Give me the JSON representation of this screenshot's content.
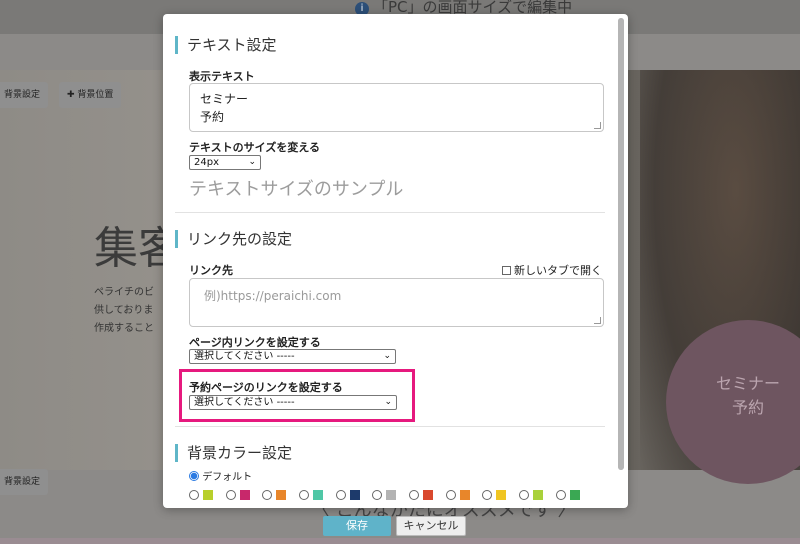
{
  "background": {
    "top_notice": "「PC」の画面サイズで編集中",
    "buttons": {
      "bg_setting": "背景設定",
      "bg_position": "✚ 背景位置"
    },
    "hero_heading": "集客",
    "hero_para_lines": [
      "ペライチのビ",
      "供しておりま",
      "作成すること"
    ],
    "circle_line1": "セミナー",
    "circle_line2": "予約",
    "bottom_text": "〈 こんなかたにオススメです 〉"
  },
  "modal": {
    "text_section": {
      "title": "テキスト設定",
      "display_text_label": "表示テキスト",
      "display_text_line1": "セミナー",
      "display_text_line2": "予約",
      "size_label": "テキストのサイズを変える",
      "size_value": "24px",
      "sample": "テキストサイズのサンプル"
    },
    "link_section": {
      "title": "リンク先の設定",
      "link_label": "リンク先",
      "new_tab_label": "新しいタブで開く",
      "link_placeholder": "例)https://peraichi.com",
      "page_link_label": "ページ内リンクを設定する",
      "page_link_value": "選択してください -----",
      "reserve_link_label": "予約ページのリンクを設定する",
      "reserve_link_value": "選択してください -----"
    },
    "color_section": {
      "title": "背景カラー設定",
      "default_label": "デフォルト",
      "swatches": [
        "#b8cf2a",
        "#c8286b",
        "#e8862a",
        "#4fc7a6",
        "#1d3a6b",
        "#b3b3b3",
        "#d9482d",
        "#e8862a",
        "#f0c521",
        "#a9d13a",
        "#3aa853"
      ]
    }
  },
  "footer": {
    "save": "保存",
    "cancel": "キャンセル"
  },
  "colors": {
    "accent": "#5fb6c8",
    "highlight": "#e6197e"
  }
}
